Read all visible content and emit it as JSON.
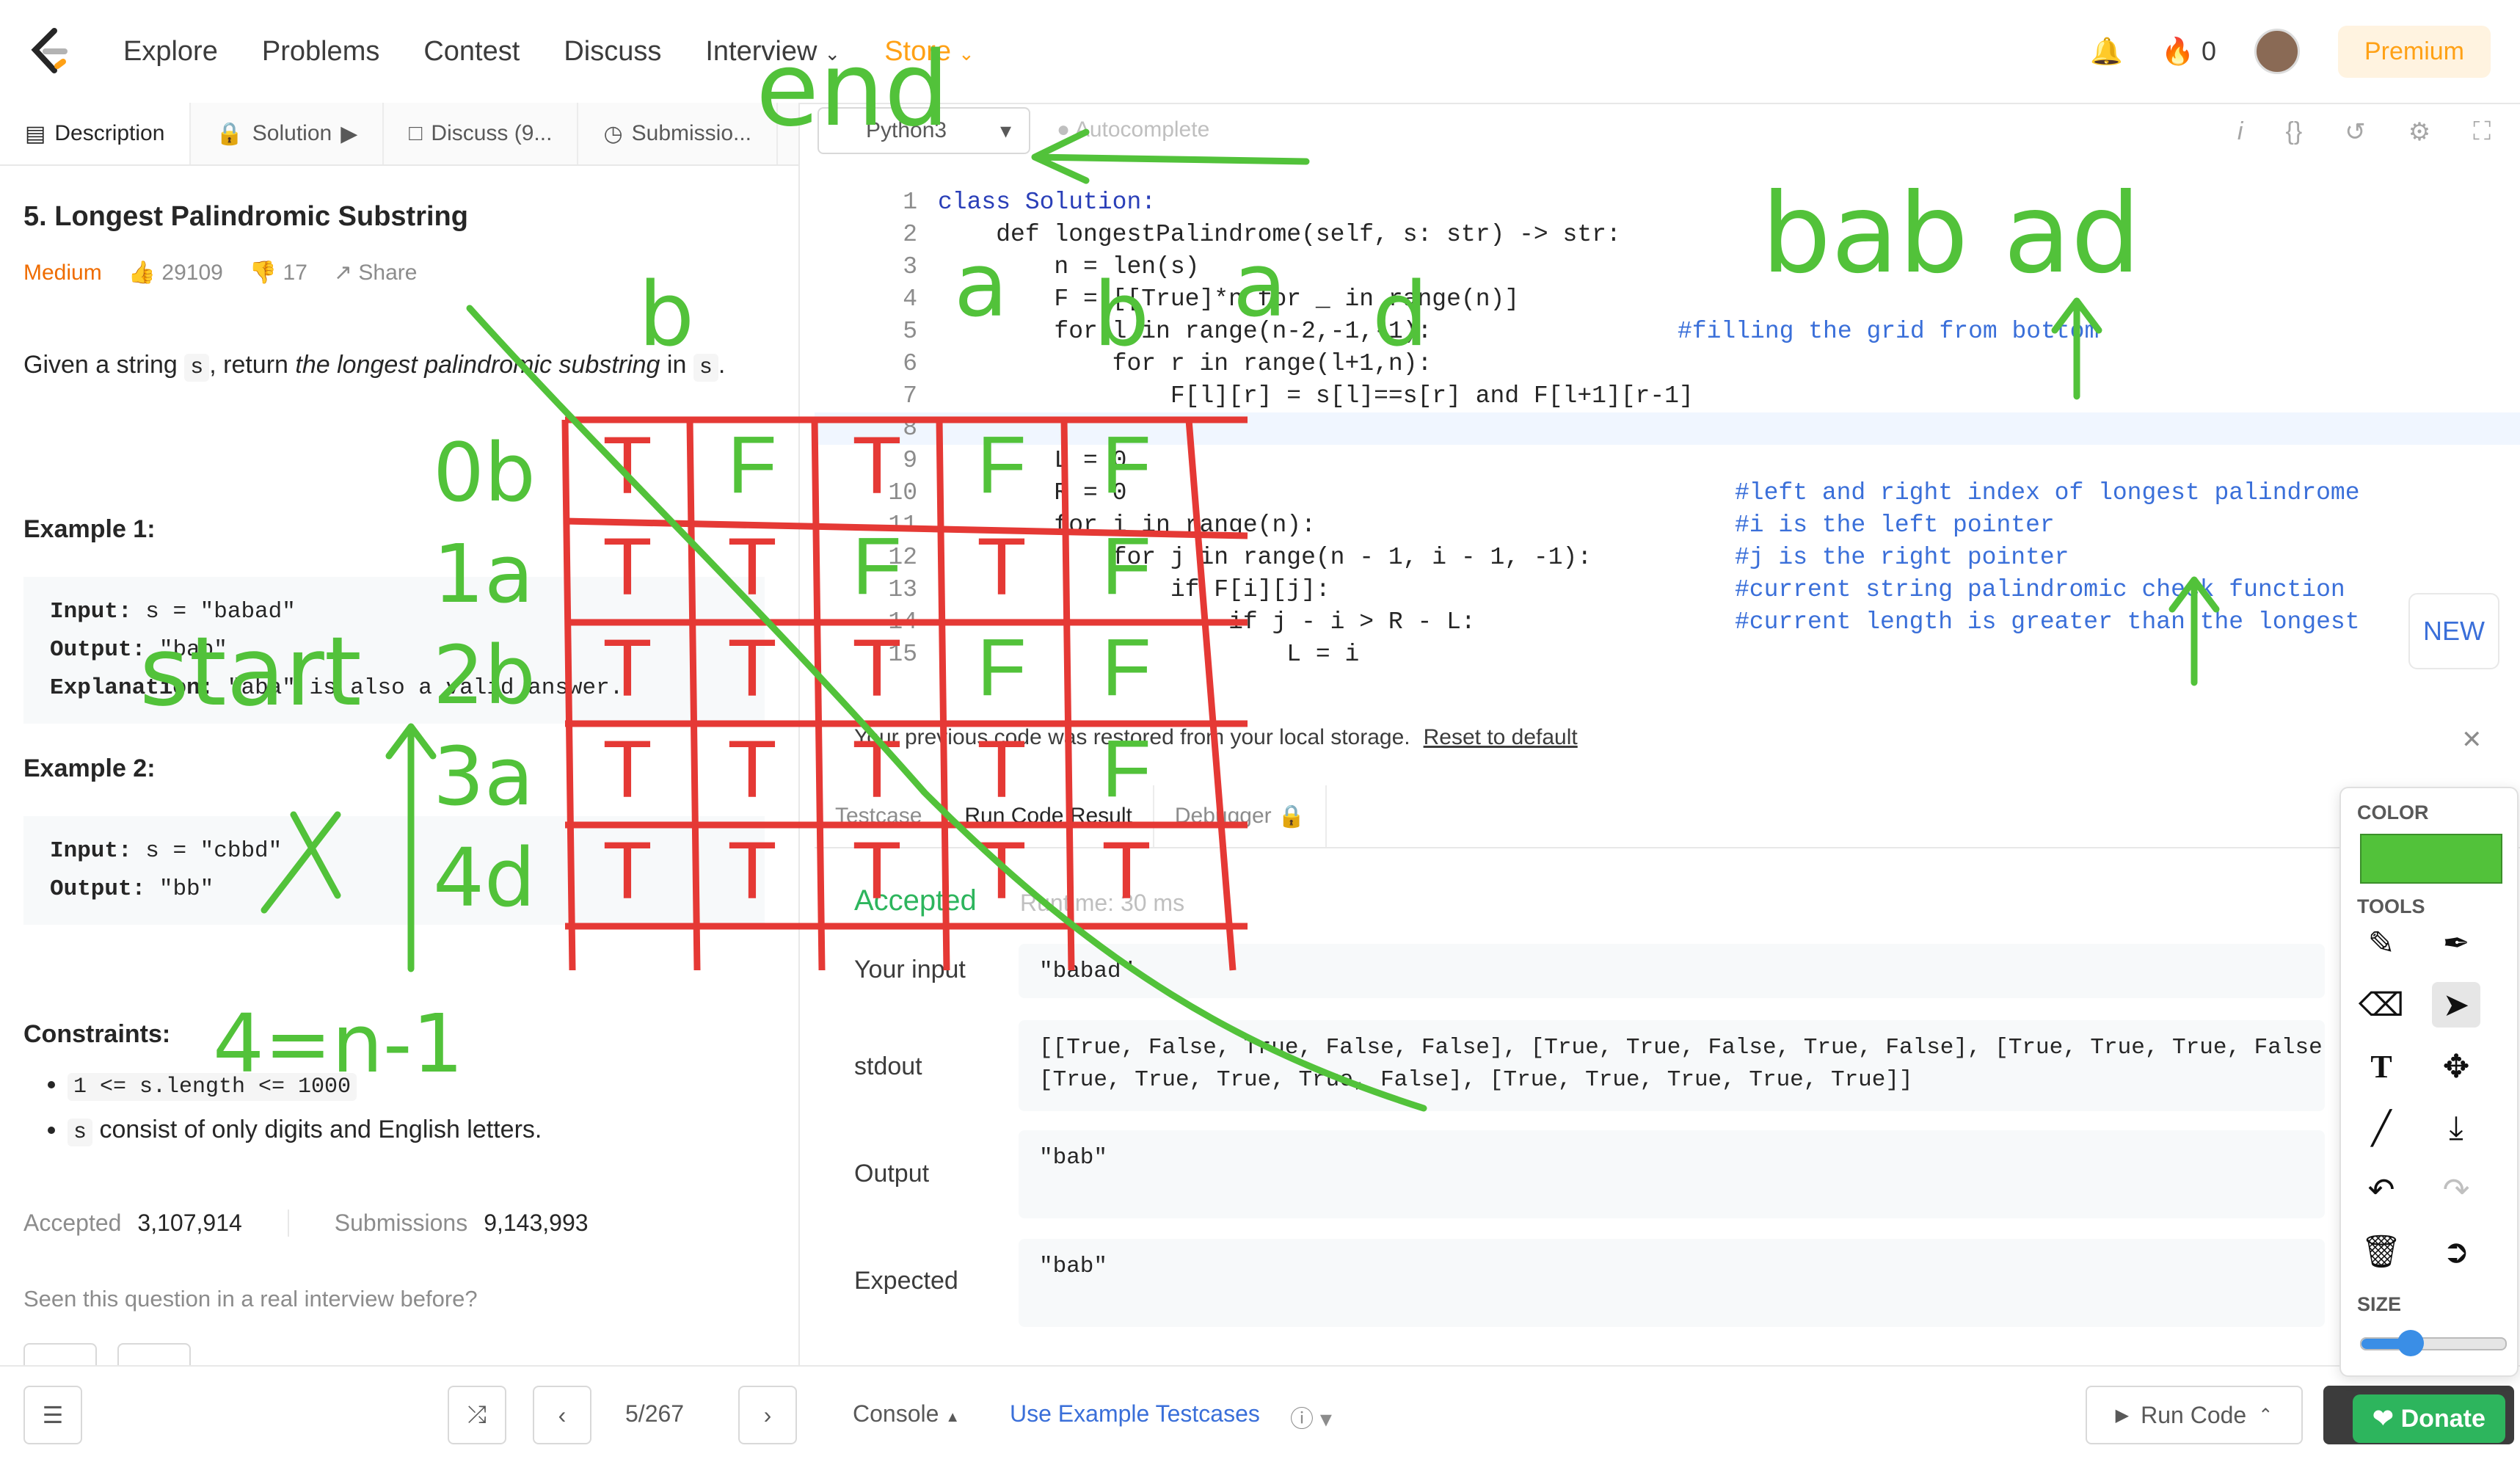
{
  "nav": {
    "items": [
      "Explore",
      "Problems",
      "Contest",
      "Discuss",
      "Interview",
      "Store"
    ],
    "streak_count": "0",
    "premium_label": "Premium"
  },
  "left_tabs": [
    "Description",
    "Solution",
    "Discuss (9...",
    "Submissio..."
  ],
  "problem": {
    "title": "5. Longest Palindromic Substring",
    "difficulty": "Medium",
    "likes": "29109",
    "dislikes": "17",
    "share_label": "Share",
    "desc_pre": "Given a string",
    "desc_code": "s",
    "desc_mid": ", return",
    "desc_em": "the longest palindromic substring",
    "desc_post": "in",
    "desc_code2": "s",
    "desc_end": "."
  },
  "examples": {
    "ex1_title": "Example 1:",
    "ex1_input_label": "Input:",
    "ex1_input": "s = \"babad\"",
    "ex1_output_label": "Output:",
    "ex1_output": "\"bab\"",
    "ex1_expl_label": "Explanation:",
    "ex1_expl": "\"aba\" is also a valid answer.",
    "ex2_title": "Example 2:",
    "ex2_input_label": "Input:",
    "ex2_input": "s = \"cbbd\"",
    "ex2_output_label": "Output:",
    "ex2_output": "\"bb\""
  },
  "constraints": {
    "title": "Constraints:",
    "c1_code": "1 <= s.length <= 1000",
    "c2_code": "s",
    "c2_text": "consist of only digits and English letters."
  },
  "stats": {
    "accepted_label": "Accepted",
    "accepted": "3,107,914",
    "submissions_label": "Submissions",
    "submissions": "9,143,993",
    "seen_question": "Seen this question in a real interview before?"
  },
  "editor": {
    "language": "Python3",
    "autocomplete_label": "Autocomplete",
    "line_numbers": [
      "1",
      "2",
      "3",
      "4",
      "5",
      "6",
      "7",
      "8",
      "9",
      "10",
      "11",
      "12",
      "13",
      "14",
      "15"
    ],
    "code_lines": [
      "class Solution:",
      "    def longestPalindrome(self, s: str) -> str:",
      "        n = len(s)",
      "        F = [[True]*n for _ in range(n)]",
      "        for l in range(n-2,-1,-1):",
      "            for r in range(l+1,n):",
      "                F[l][r] = s[l]==s[r] and F[l+1][r-1]",
      "",
      "        L = 0",
      "        R = 0",
      "        for i in range(n):",
      "            for j in range(n - 1, i - 1, -1):",
      "                if F[i][j]:",
      "                    if j - i > R - L:",
      "                        L = i"
    ],
    "comment_fill": "#filling the grid from bottom",
    "comments": [
      "#left and right index of longest palindrome",
      "#i is the left pointer",
      "#j is the right pointer",
      "#current string palindromic check function",
      "#current length is greater than the longest"
    ],
    "new_badge": "NEW"
  },
  "restore": {
    "message": "Your previous code was restored from your local storage.",
    "reset_link": "Reset to default"
  },
  "result_tabs": [
    "Testcase",
    "Run Code Result",
    "Debugger"
  ],
  "result": {
    "status": "Accepted",
    "runtime": "Runtime: 30 ms",
    "input_label": "Your input",
    "input_value": "\"babad\"",
    "stdout_label": "stdout",
    "stdout_value": "[[True, False, True, False, False], [True, True, False, True, False], [True, True, True, False, False],\n[True, True, True, True, False], [True, True, True, True, True]]",
    "output_label": "Output",
    "output_value": "\"bab\"",
    "expected_label": "Expected",
    "expected_value": "\"bab\""
  },
  "bottom": {
    "page_indicator": "5/267",
    "console_label": "Console",
    "use_example_label": "Use Example Testcases",
    "run_code_label": "Run Code"
  },
  "tools_panel": {
    "color_label": "COLOR",
    "selected_color": "#52c23a",
    "tools_label": "TOOLS",
    "size_label": "SIZE",
    "size_level": 0.3,
    "donate_label": "Donate",
    "tool_icons": [
      "pencil-icon",
      "highlighter-icon",
      "eraser-icon",
      "cursor-icon",
      "text-icon",
      "move-icon",
      "line-icon",
      "download-icon",
      "undo-icon",
      "redo-icon",
      "trash-icon",
      "exit-icon"
    ]
  },
  "annotations": {
    "ink_red": "#e53935",
    "ink_green": "#52c23a",
    "grid_cells": [
      [
        "T",
        "F",
        "T",
        "F",
        "F"
      ],
      [
        "T",
        "T",
        "F",
        "T",
        "F"
      ],
      [
        "T",
        "T",
        "T",
        "F",
        "F"
      ],
      [
        "T",
        "T",
        "T",
        "T",
        "F"
      ],
      [
        "T",
        "T",
        "T",
        "T",
        "T"
      ]
    ],
    "row_labels": [
      "0b",
      "1a",
      "2b",
      "3a",
      "4d"
    ],
    "col_labels": [
      "b",
      "a",
      "b",
      "a",
      "d"
    ],
    "handwriting_end": "end",
    "handwriting_start": "start",
    "handwriting_string": "bab ad",
    "handwriting_formula": "4=n-1"
  }
}
